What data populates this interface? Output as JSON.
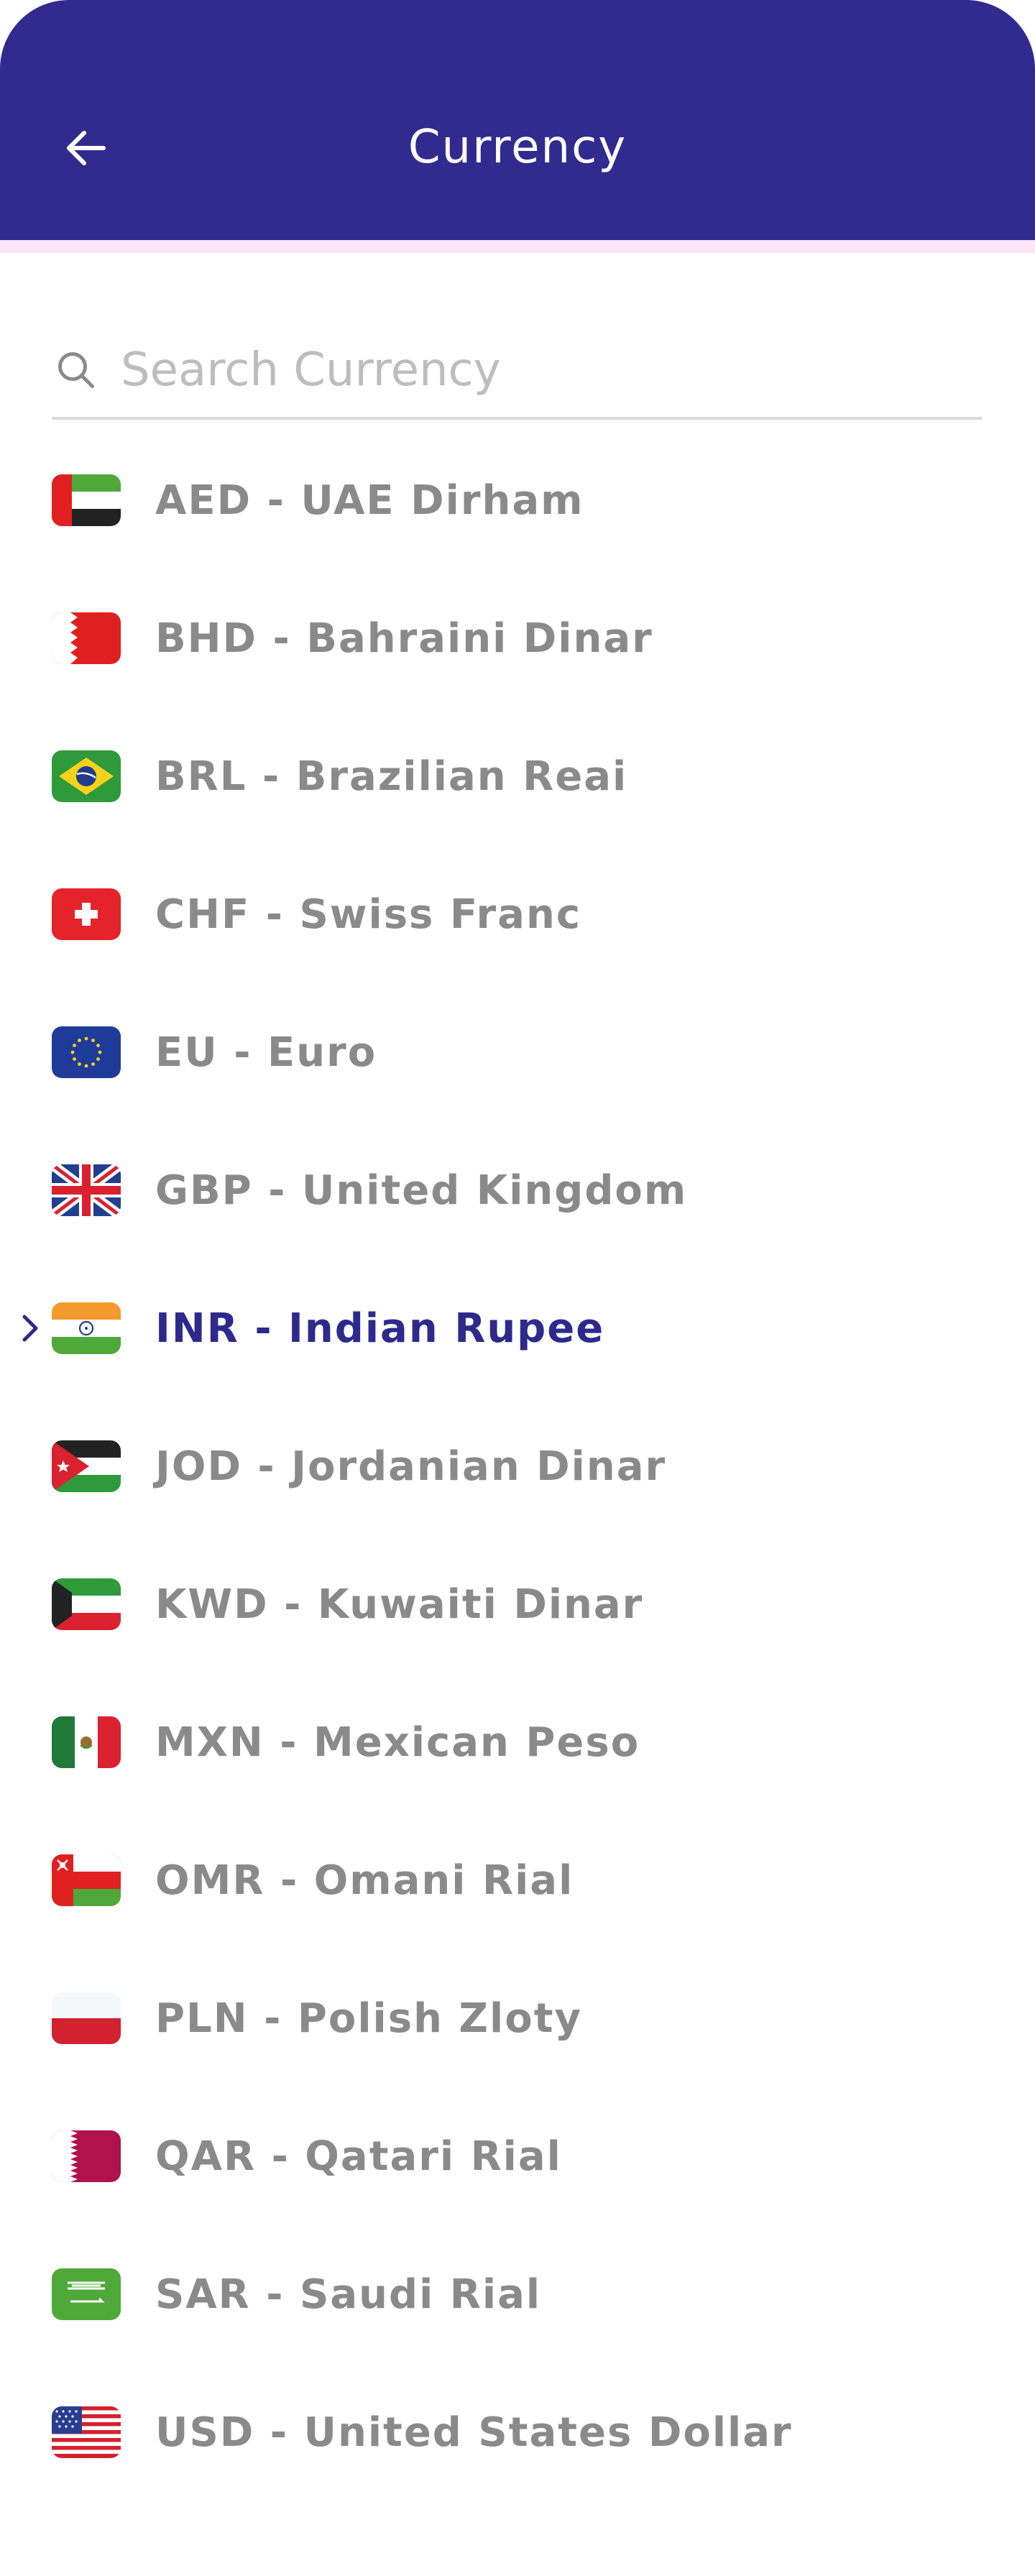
{
  "header": {
    "title": "Currency",
    "back_icon": "arrow-left-icon",
    "bg_color": "#312a8f"
  },
  "search": {
    "placeholder": "Search Currency",
    "value": "",
    "icon": "search-icon"
  },
  "currencies": [
    {
      "label": "AED - UAE Dirham",
      "flag": "uae-flag-icon",
      "selected": false
    },
    {
      "label": "BHD - Bahraini Dinar",
      "flag": "bahrain-flag-icon",
      "selected": false
    },
    {
      "label": "BRL - Brazilian Reai",
      "flag": "brazil-flag-icon",
      "selected": false
    },
    {
      "label": "CHF - Swiss Franc",
      "flag": "switzerland-flag-icon",
      "selected": false
    },
    {
      "label": "EU - Euro",
      "flag": "eu-flag-icon",
      "selected": false
    },
    {
      "label": "GBP - United Kingdom",
      "flag": "uk-flag-icon",
      "selected": false
    },
    {
      "label": "INR - Indian Rupee",
      "flag": "india-flag-icon",
      "selected": true
    },
    {
      "label": "JOD - Jordanian Dinar",
      "flag": "jordan-flag-icon",
      "selected": false
    },
    {
      "label": "KWD - Kuwaiti Dinar",
      "flag": "kuwait-flag-icon",
      "selected": false
    },
    {
      "label": "MXN - Mexican Peso",
      "flag": "mexico-flag-icon",
      "selected": false
    },
    {
      "label": "OMR - Omani Rial",
      "flag": "oman-flag-icon",
      "selected": false
    },
    {
      "label": "PLN - Polish Zloty",
      "flag": "poland-flag-icon",
      "selected": false
    },
    {
      "label": "QAR - Qatari Rial",
      "flag": "qatar-flag-icon",
      "selected": false
    },
    {
      "label": "SAR - Saudi Rial",
      "flag": "saudi-flag-icon",
      "selected": false
    },
    {
      "label": "USD - United States Dollar",
      "flag": "usa-flag-icon",
      "selected": false
    }
  ],
  "colors": {
    "accent": "#2e2a8c",
    "item_text": "#8a8a8a",
    "header_strip": "#fbe6f9"
  }
}
